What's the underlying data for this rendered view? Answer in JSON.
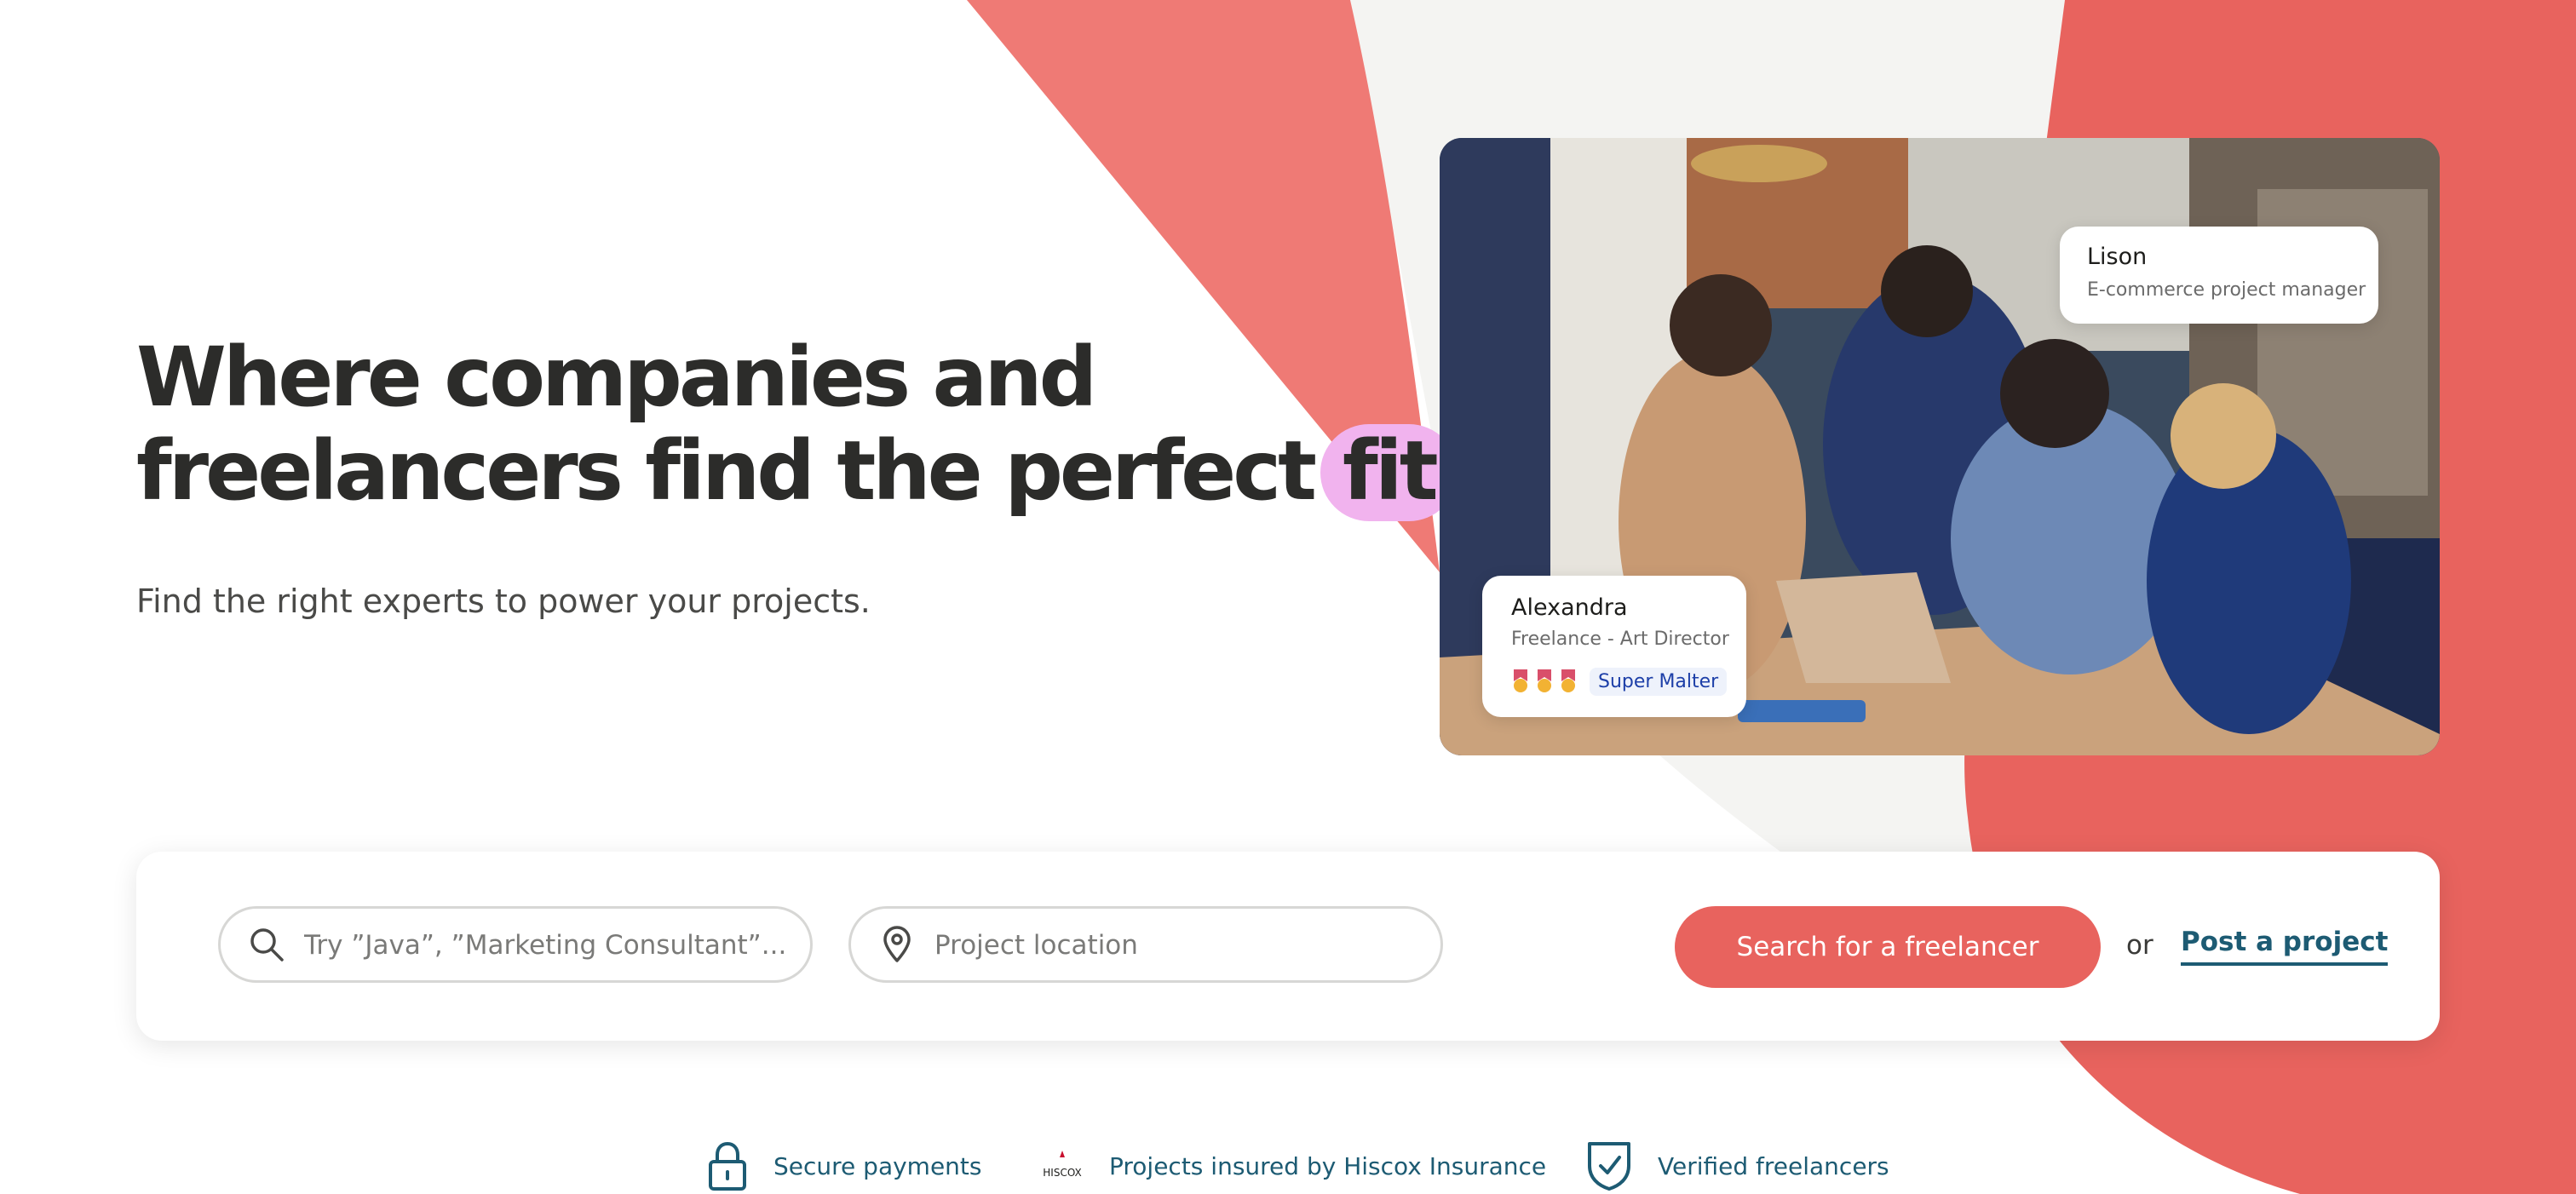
{
  "hero": {
    "title_line1": "Where companies and",
    "title_line2": "freelancers find the perfect",
    "title_highlight": "fit",
    "subtitle": "Find the right experts to power your projects."
  },
  "cards": {
    "lison": {
      "name": "Lison",
      "role": "E-commerce project manager"
    },
    "alexandra": {
      "name": "Alexandra",
      "role": "Freelance - Art Director",
      "badge": "Super Malter"
    }
  },
  "search": {
    "query_placeholder": "Try ”Java”, ”Marketing Consultant”...",
    "location_placeholder": "Project location",
    "submit_label": "Search for a freelancer",
    "or_label": "or",
    "post_label": "Post a project"
  },
  "trust": {
    "secure": "Secure payments",
    "hiscox_logo": "HISCOX",
    "hiscox": "Projects insured by Hiscox Insurance",
    "verified": "Verified freelancers"
  },
  "colors": {
    "accent": "#e8635e",
    "coral_light": "#ef7a75",
    "highlight": "#f1b3ee",
    "link": "#1d5b73",
    "text": "#2c2c2a"
  },
  "icons": [
    "search-icon",
    "location-pin-icon",
    "lock-icon",
    "shield-check-icon",
    "medal-icon"
  ]
}
